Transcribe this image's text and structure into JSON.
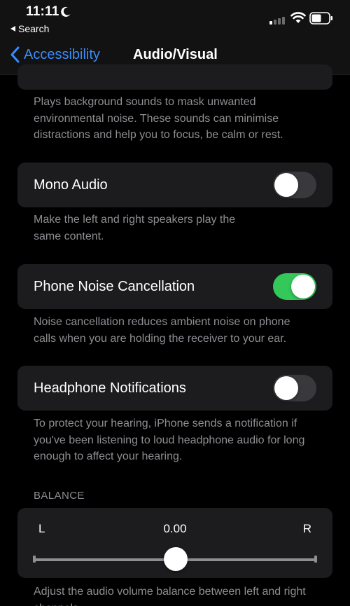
{
  "status_bar": {
    "time": "11:11",
    "back_to_app": "Search"
  },
  "nav": {
    "back_label": "Accessibility",
    "title": "Audio/Visual"
  },
  "background_sounds": {
    "description": "Plays background sounds to mask unwanted environmental noise. These sounds can minimise distractions and help you to focus, be calm or rest."
  },
  "mono_audio": {
    "label": "Mono Audio",
    "enabled": false,
    "description": "Make the left and right speakers play the same content."
  },
  "phone_noise_cancellation": {
    "label": "Phone Noise Cancellation",
    "enabled": true,
    "description": "Noise cancellation reduces ambient noise on phone calls when you are holding the receiver to your ear."
  },
  "headphone_notifications": {
    "label": "Headphone Notifications",
    "enabled": false,
    "description": "To protect your hearing, iPhone sends a notification if you've been listening to loud headphone audio for long enough to affect your hearing."
  },
  "balance": {
    "section_header": "BALANCE",
    "left_label": "L",
    "right_label": "R",
    "value_text": "0.00",
    "value": 0.0,
    "min": -1.0,
    "max": 1.0,
    "description": "Adjust the audio volume balance between left and right channels."
  },
  "colors": {
    "accent": "#3b8cf7",
    "toggle_on": "#34c759",
    "toggle_off": "#39393d",
    "cell_background": "#1c1c1e",
    "secondary_text": "#8e8e93"
  },
  "icons": {
    "moon": "moon-icon",
    "signal": "cellular-signal-icon",
    "wifi": "wifi-icon",
    "battery": "battery-icon",
    "back": "chevron-left-icon"
  }
}
